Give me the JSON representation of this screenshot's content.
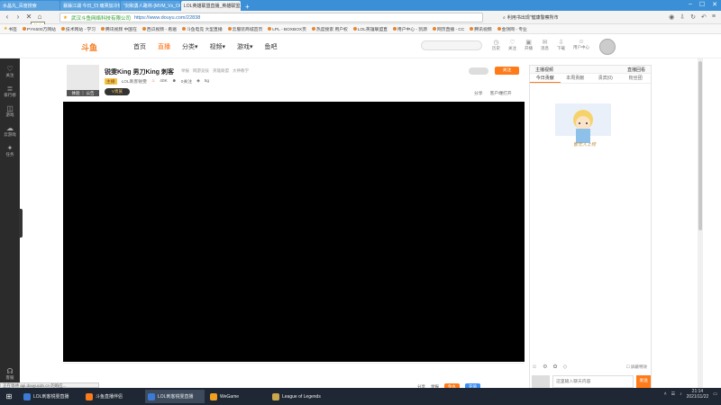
{
  "browser": {
    "tabs": [
      {
        "label": "水晶丸_百度搜索",
        "active": false
      },
      {
        "label": "暴躁江湖 今日_归 痛哭加冷热",
        "active": false
      },
      {
        "label": "\"剑和勇人路林-[MVM_Vs_OG-2021",
        "active": false
      },
      {
        "label": "LOL英雄联盟直播_英雄联盟直播_斗",
        "active": true
      }
    ],
    "new_tab": "+",
    "tooltip": "停止",
    "address": {
      "security_label": "武汉斗鱼网络科技有限公司",
      "url": "https://www.douyu.com/22838"
    },
    "right_search": "利用书出现\"健康警察所市",
    "bookmarks": [
      "书签",
      "PYK600万网站",
      "技术网站 - 学习",
      "腾讯视频 中国在",
      "西瓜视频 - 看遍",
      "斗鱼电竞 大型直播",
      "云服装商城首页",
      "LPL - BOXBOX页",
      "热度搜索 用户权",
      "LOL英雄联盟直",
      "用户中心 - 凯源",
      "网页直播 - CC",
      "腾讯视频",
      "金领网 - 专业"
    ]
  },
  "site": {
    "logo": "斗鱼",
    "nav": [
      "首页",
      "直播",
      "分类▾",
      "视频▾",
      "游戏▾",
      "鱼吧"
    ],
    "active_nav": 1,
    "header_icons": [
      {
        "icon": "history-icon",
        "label": "历史"
      },
      {
        "icon": "follow-icon",
        "label": "关注"
      },
      {
        "icon": "live-icon",
        "label": "开播"
      },
      {
        "icon": "message-icon",
        "label": "消息"
      },
      {
        "icon": "download-icon",
        "label": "下载"
      },
      {
        "icon": "user-center-icon",
        "label": "用户中心"
      }
    ]
  },
  "sidebar": {
    "items": [
      {
        "icon": "heart-icon",
        "label": "关注"
      },
      {
        "icon": "rank-icon",
        "label": "排行榜"
      },
      {
        "icon": "game-icon",
        "label": "游戏"
      },
      {
        "icon": "cloud-game-icon",
        "label": "云游戏"
      },
      {
        "icon": "task-icon",
        "label": "任务"
      }
    ],
    "bottom_label": "客服"
  },
  "room": {
    "thumb_label": "体验 ｜ 公告",
    "title": "锐雯King 男刀King 刺客",
    "category": [
      "举报",
      "网游竞技",
      "英雄联盟",
      "大神教学"
    ],
    "badge": "主播",
    "anchor": "LOL刺客锐雯",
    "heat": "40K",
    "fans": "0关注",
    "level": "5g",
    "vip": "V贵族",
    "follow": "关注",
    "share": "分享",
    "client": "客户端打开"
  },
  "bottom": {
    "actions": [
      "分享",
      "举报"
    ],
    "orange_btn": "鱼丸",
    "blue_btn": "充值"
  },
  "right_panel": {
    "head_left": "主播视频",
    "head_right": "直播回看",
    "tabs": [
      "今日贡献",
      "本周贡献",
      "贵宾(0)",
      "粉丝团"
    ],
    "mascot_text": "暂无人上榜",
    "block_label": "屏蔽特效",
    "chat_placeholder": "这里输入聊天内容",
    "send": "发送"
  },
  "status_bar": "正在等待 api.douyucdn.cn 的响应...",
  "taskbar": {
    "tasks": [
      {
        "label": "LOL刺客锐雯直播",
        "color": "#3b7bd6",
        "active": false
      },
      {
        "label": "斗鱼直播伴侣",
        "color": "#ff7b1a",
        "active": false
      },
      {
        "label": "LOL刺客锐雯直播",
        "color": "#3b7bd6",
        "active": true
      },
      {
        "label": "WeGame",
        "color": "#f0a020",
        "active": false
      },
      {
        "label": "League of Legends",
        "color": "#c8a84a",
        "active": false
      }
    ],
    "time": "21:14",
    "date": "2021/11/22"
  }
}
